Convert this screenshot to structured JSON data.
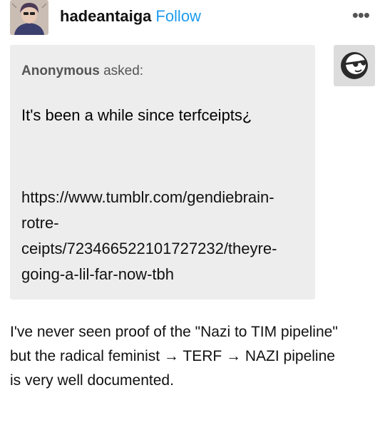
{
  "post": {
    "username": "hadeantaiga",
    "follow_label": "Follow",
    "more_label": "•••"
  },
  "ask": {
    "asker_name": "Anonymous",
    "asked_label": "asked:",
    "question": "It's been a while since terfceipts¿",
    "link_lines": [
      "https://www.tumblr.com/gendiebrain-",
      "rotre-",
      "ceipts/723466522101727232/theyre-",
      "going-a-lil-far-now-tbh"
    ]
  },
  "answer": {
    "lines": [
      "I've never seen proof of the \"Nazi to TIM pipeline\"",
      "but the radical feminist → TERF → NAZI pipeline",
      "is very well documented."
    ]
  },
  "icons": {
    "poster_avatar": "avatar",
    "anon_avatar": "anonymous-sunglasses-icon",
    "more": "more-options-icon"
  }
}
